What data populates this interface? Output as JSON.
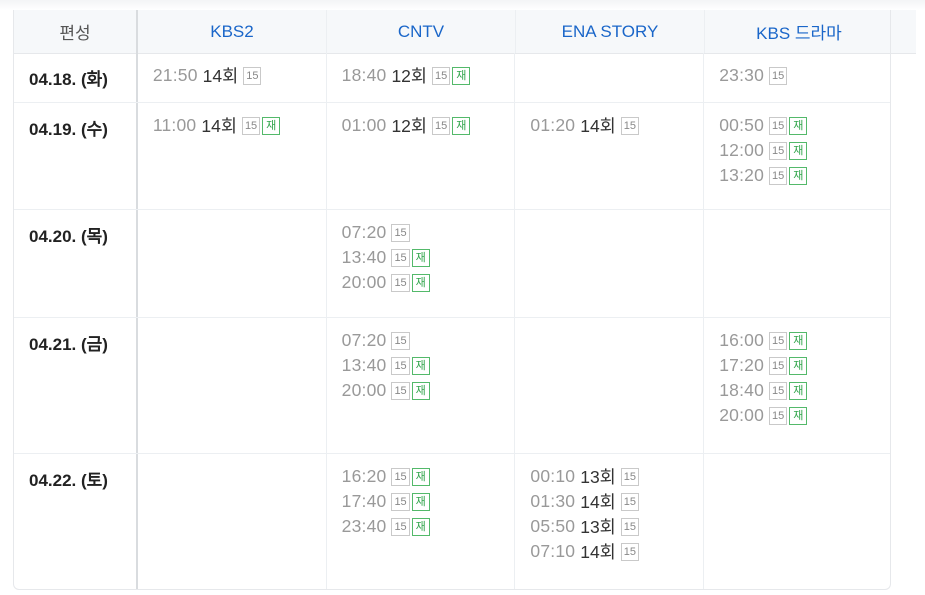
{
  "header": {
    "schedule_label": "편성",
    "channels": [
      "KBS2",
      "CNTV",
      "ENA STORY",
      "KBS 드라마"
    ]
  },
  "badges": {
    "rating": "15",
    "rerun": "재"
  },
  "rows": [
    {
      "date": "04.18. (화)",
      "cells": [
        [
          {
            "time": "21:50",
            "ep": "14회",
            "re": false
          }
        ],
        [
          {
            "time": "18:40",
            "ep": "12회",
            "re": true
          }
        ],
        [],
        [
          {
            "time": "23:30",
            "ep": "",
            "re": false
          }
        ]
      ]
    },
    {
      "date": "04.19. (수)",
      "cells": [
        [
          {
            "time": "11:00",
            "ep": "14회",
            "re": true
          }
        ],
        [
          {
            "time": "01:00",
            "ep": "12회",
            "re": true
          }
        ],
        [
          {
            "time": "01:20",
            "ep": "14회",
            "re": false
          }
        ],
        [
          {
            "time": "00:50",
            "ep": "",
            "re": true
          },
          {
            "time": "12:00",
            "ep": "",
            "re": true
          },
          {
            "time": "13:20",
            "ep": "",
            "re": true
          }
        ]
      ]
    },
    {
      "date": "04.20. (목)",
      "cells": [
        [],
        [
          {
            "time": "07:20",
            "ep": "",
            "re": false
          },
          {
            "time": "13:40",
            "ep": "",
            "re": true
          },
          {
            "time": "20:00",
            "ep": "",
            "re": true
          }
        ],
        [],
        []
      ]
    },
    {
      "date": "04.21. (금)",
      "cells": [
        [],
        [
          {
            "time": "07:20",
            "ep": "",
            "re": false
          },
          {
            "time": "13:40",
            "ep": "",
            "re": true
          },
          {
            "time": "20:00",
            "ep": "",
            "re": true
          }
        ],
        [],
        [
          {
            "time": "16:00",
            "ep": "",
            "re": true
          },
          {
            "time": "17:20",
            "ep": "",
            "re": true
          },
          {
            "time": "18:40",
            "ep": "",
            "re": true
          },
          {
            "time": "20:00",
            "ep": "",
            "re": true
          }
        ]
      ]
    },
    {
      "date": "04.22. (토)",
      "cells": [
        [],
        [
          {
            "time": "16:20",
            "ep": "",
            "re": true
          },
          {
            "time": "17:40",
            "ep": "",
            "re": true
          },
          {
            "time": "23:40",
            "ep": "",
            "re": true
          }
        ],
        [
          {
            "time": "00:10",
            "ep": "13회",
            "re": false
          },
          {
            "time": "01:30",
            "ep": "14회",
            "re": false
          },
          {
            "time": "05:50",
            "ep": "13회",
            "re": false
          },
          {
            "time": "07:10",
            "ep": "14회",
            "re": false
          }
        ],
        []
      ]
    }
  ],
  "colors": {
    "channel_link": "#1a66c9",
    "rerun_badge": "#2fa44a",
    "header_bg": "#f6f8fa"
  }
}
